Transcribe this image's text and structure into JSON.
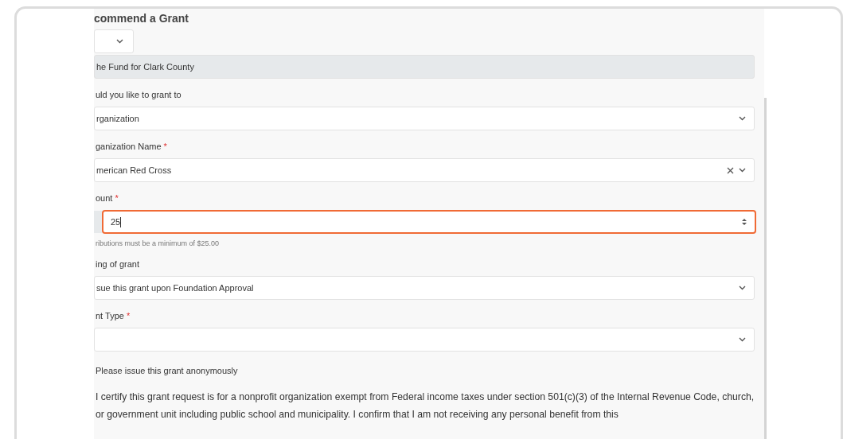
{
  "title": "commend a Grant",
  "fields": [
    {
      "kind": "small-select"
    },
    {
      "kind": "readonly",
      "value": "he Fund for Clark County"
    },
    {
      "kind": "select",
      "label": "uld you like to grant to",
      "value": "rganization"
    },
    {
      "kind": "clearable-select",
      "label": "ganization Name",
      "required_mark": "*",
      "value": "merican Red Cross"
    },
    {
      "kind": "number",
      "label": "ount",
      "required_mark": "*",
      "value": "25",
      "highlighted": true,
      "help": "ributions must be a minimum of $25.00"
    },
    {
      "kind": "select",
      "label": "ing of grant",
      "value": "sue this grant upon Foundation Approval"
    },
    {
      "kind": "select",
      "label": "nt Type",
      "required_mark": "*"
    },
    {
      "kind": "checkbox",
      "label": "Please issue this grant anonymously"
    },
    {
      "kind": "paragraph",
      "text": "I certify this grant request is for a nonprofit organization exempt from Federal income taxes under section 501(c)(3) of the Internal Revenue Code, church, or government unit including public school and municipality. I confirm that I am not receiving any personal benefit from this"
    }
  ]
}
